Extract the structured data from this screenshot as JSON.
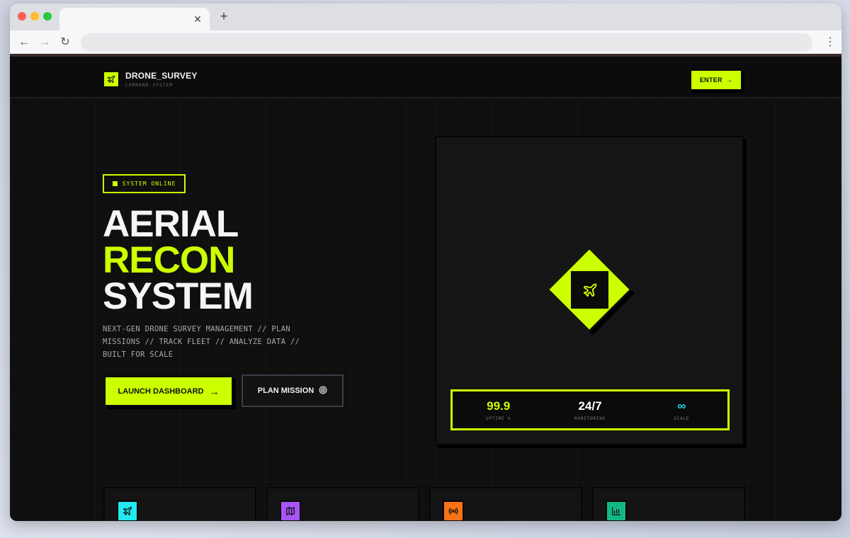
{
  "browser": {
    "tab_close": "✕",
    "new_tab": "+",
    "back": "←",
    "forward": "→",
    "reload": "↻",
    "menu": "⋮"
  },
  "nav": {
    "brand_name": "DRONE_SURVEY",
    "brand_sub": "COMMAND SYSTEM",
    "brand_icon": "plane-icon",
    "enter_label": "ENTER"
  },
  "hero": {
    "status": "SYSTEM ONLINE",
    "headline": [
      "AERIAL",
      "RECON",
      "SYSTEM"
    ],
    "tagline": "NEXT-GEN DRONE SURVEY MANAGEMENT // PLAN MISSIONS // TRACK FLEET // ANALYZE DATA // BUILT FOR SCALE",
    "launch_label": "LAUNCH DASHBOARD",
    "plan_label": "PLAN MISSION"
  },
  "stats": [
    {
      "value": "99.9",
      "label": "UPTIME %",
      "color": "#ccff00"
    },
    {
      "value": "24/7",
      "label": "MONITORING",
      "color": "#ffffff"
    },
    {
      "value": "∞",
      "label": "SCALE",
      "color": "#22d3ee"
    }
  ],
  "features": [
    {
      "icon": "plane-icon",
      "color": "#22e8f0"
    },
    {
      "icon": "map-icon",
      "color": "#a855f7"
    },
    {
      "icon": "broadcast-icon",
      "color": "#f97316"
    },
    {
      "icon": "bar-chart-icon",
      "color": "#14b886"
    }
  ],
  "colors": {
    "accent": "#ccff00",
    "background": "#0f0f0f",
    "panel": "#151515"
  }
}
